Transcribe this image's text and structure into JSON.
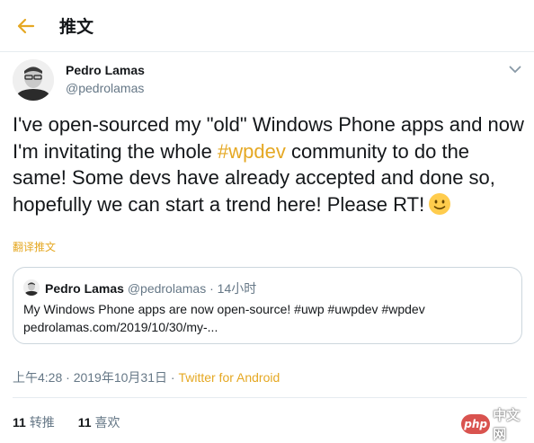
{
  "colors": {
    "accent": "#e5a823",
    "text": "#14171a",
    "secondary": "#657786",
    "border": "#ccd6dd"
  },
  "header": {
    "title": "推文",
    "back_icon": "arrow-left-icon"
  },
  "tweet": {
    "author_name": "Pedro Lamas",
    "author_handle": "@pedrolamas",
    "menu_icon": "chevron-down-icon",
    "text_parts": {
      "p1": "I've open-sourced my \"old\" Windows Phone apps and now I'm invitating the whole ",
      "hashtag": "#wpdev",
      "p2": " community to do the same! Some devs have already accepted and done so, hopefully we can start a trend here! Please RT!"
    },
    "emoji": "slightly-smiling-face",
    "translate_label": "翻译推文"
  },
  "quoted_tweet": {
    "name": "Pedro Lamas",
    "handle": "@pedrolamas",
    "separator": " · ",
    "time": "14小时",
    "line1": "My Windows Phone apps are now open-source! #uwp #uwpdev #wpdev",
    "line2": "pedrolamas.com/2019/10/30/my-..."
  },
  "meta": {
    "time": "上午4:28 · 2019年10月31日",
    "separator": " · ",
    "source": "Twitter for Android"
  },
  "stats": {
    "retweets_count": "11",
    "retweets_label": "转推",
    "likes_count": "11",
    "likes_label": "喜欢"
  },
  "watermark": {
    "badge": "php",
    "text": "中文网"
  }
}
